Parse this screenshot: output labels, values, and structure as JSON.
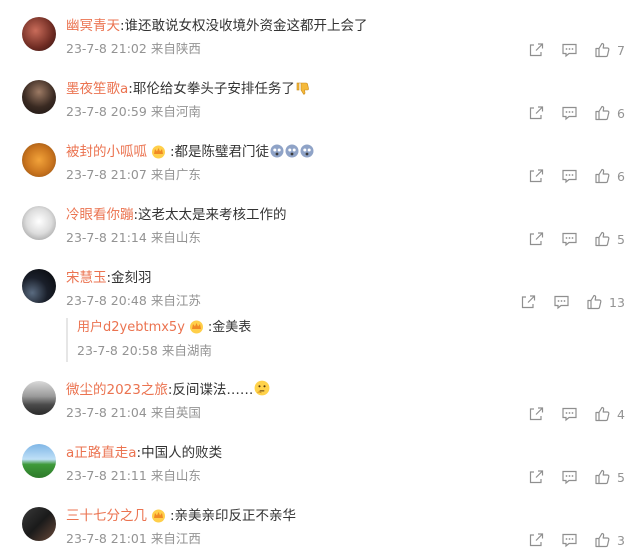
{
  "comments": [
    {
      "user": "幽冥青天",
      "text": ":谁还敢说女权没收境外资金这都开上会了",
      "time": "23-7-8 21:02",
      "loc": "来自陕西",
      "likes": "7"
    },
    {
      "user": "墨夜笙歌a",
      "text": ":耶伦给女拳头子安排任务了",
      "time": "23-7-8 20:59",
      "loc": "来自河南",
      "likes": "6"
    },
    {
      "user": "被封的小呱呱",
      "text": ":都是陈璧君门徒",
      "time": "23-7-8 21:07",
      "loc": "来自广东",
      "likes": "6"
    },
    {
      "user": "冷眼看你蹦",
      "text": ":这老太太是来考核工作的",
      "time": "23-7-8 21:14",
      "loc": "来自山东",
      "likes": "5"
    },
    {
      "user": "宋慧玉",
      "text": ":金刻羽",
      "time": "23-7-8 20:48",
      "loc": "来自江苏",
      "likes": "13"
    },
    {
      "user": "微尘的2023之旅",
      "text": ":反间谍法……",
      "time": "23-7-8 21:04",
      "loc": "来自英国",
      "likes": "4"
    },
    {
      "user": "a正路直走a",
      "text": ":中国人的败类",
      "time": "23-7-8 21:11",
      "loc": "来自山东",
      "likes": "5"
    },
    {
      "user": "三十七分之几",
      "text": ":亲美亲印反正不亲华",
      "time": "23-7-8 21:01",
      "loc": "来自江西",
      "likes": "3"
    }
  ],
  "reply": {
    "user": "用户d2yebtmx5y",
    "text": ":金美表",
    "time": "23-7-8 20:58",
    "loc": "来自湖南"
  },
  "colors": {
    "username": "#eb7350",
    "text": "#333333",
    "meta": "#939393",
    "icon": "#8f8f8f"
  }
}
